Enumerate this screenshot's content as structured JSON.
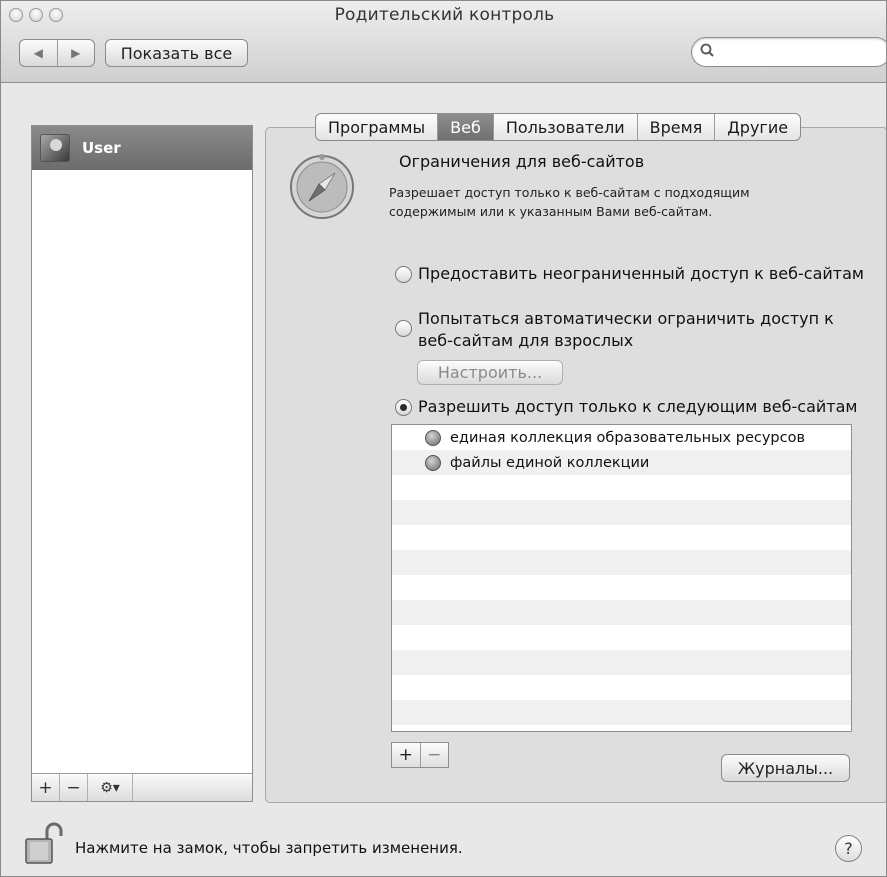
{
  "window": {
    "title": "Родительский контроль"
  },
  "toolbar": {
    "back_icon": "back-arrow-icon",
    "forward_icon": "forward-arrow-icon",
    "show_all": "Показать все",
    "search": {
      "value": "",
      "placeholder": ""
    }
  },
  "sidebar": {
    "users": [
      {
        "name": "User",
        "selected": true
      }
    ],
    "tools": [
      {
        "label": "+"
      },
      {
        "label": "−"
      },
      {
        "label": "⚙▾"
      }
    ]
  },
  "tabs": [
    {
      "label": "Программы",
      "active": false
    },
    {
      "label": "Веб",
      "active": true
    },
    {
      "label": "Пользователи",
      "active": false
    },
    {
      "label": "Время",
      "active": false
    },
    {
      "label": "Другие",
      "active": false
    }
  ],
  "web": {
    "section_title": "Ограничения для веб-сайтов",
    "section_desc": "Разрешает доступ только к веб-сайтам с подходящим содержимым или к указанным Вами веб-сайтам.",
    "options": [
      {
        "label": "Предоставить неограниченный доступ к веб-сайтам",
        "selected": false
      },
      {
        "label": "Попытаться автоматически ограничить доступ к веб-сайтам для взрослых",
        "selected": false
      },
      {
        "label": "Разрешить доступ только к следующим веб-сайтам",
        "selected": true
      }
    ],
    "customize_label": "Настроить...",
    "sites": [
      {
        "name": "единая коллекция образовательных ресурсов"
      },
      {
        "name": "файлы единой коллекции"
      }
    ],
    "add_label": "+",
    "remove_label": "−",
    "logs_label": "Журналы..."
  },
  "footer": {
    "lock_text": "Нажмите на замок, чтобы запретить изменения.",
    "help_label": "?"
  }
}
